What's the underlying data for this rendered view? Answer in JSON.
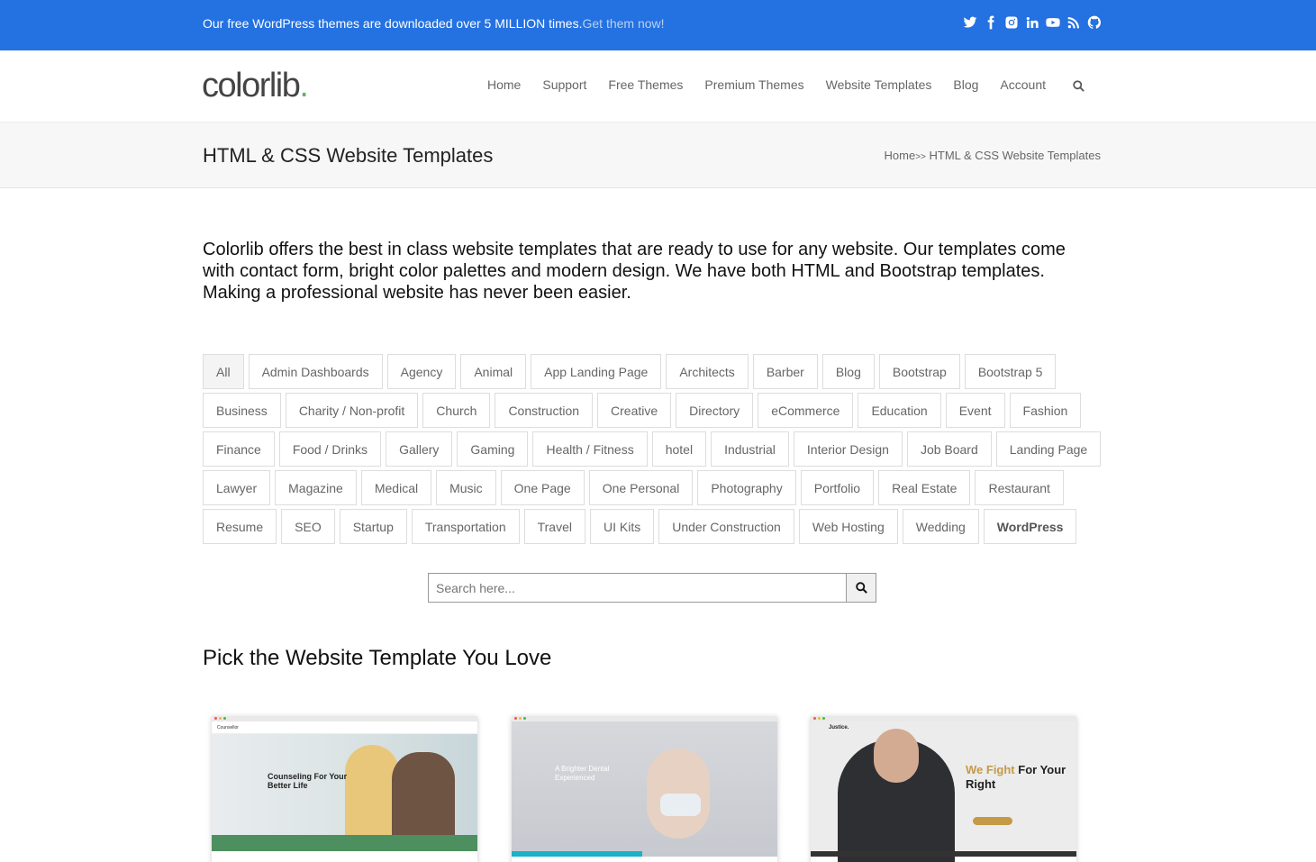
{
  "topbar": {
    "message": "Our free WordPress themes are downloaded over 5 MILLION times.",
    "cta": "Get them now!",
    "social_icons": [
      "twitter-icon",
      "facebook-icon",
      "instagram-icon",
      "linkedin-icon",
      "youtube-icon",
      "rss-icon",
      "github-icon"
    ],
    "bg_color": "#2471e1"
  },
  "header": {
    "logo_text": "colorlib",
    "logo_dot": ".",
    "logo_dot_color": "#5cb85c",
    "nav": [
      "Home",
      "Support",
      "Free Themes",
      "Premium Themes",
      "Website Templates",
      "Blog",
      "Account"
    ],
    "search_icon": "search-icon"
  },
  "title_band": {
    "title": "HTML & CSS Website Templates",
    "breadcrumb_home": "Home",
    "breadcrumb_sep": ">>",
    "breadcrumb_current": "HTML & CSS Website Templates"
  },
  "intro": "Colorlib offers the best in class website templates that are ready to use for any website. Our templates come with contact form, bright color palettes and modern design. We have both HTML and Bootstrap templates. Making a professional website has never been easier.",
  "tags": [
    "All",
    "Admin Dashboards",
    "Agency",
    "Animal",
    "App Landing Page",
    "Architects",
    "Barber",
    "Blog",
    "Bootstrap",
    "Bootstrap 5",
    "Business",
    "Charity / Non-profit",
    "Church",
    "Construction",
    "Creative",
    "Directory",
    "eCommerce",
    "Education",
    "Event",
    "Fashion",
    "Finance",
    "Food / Drinks",
    "Gallery",
    "Gaming",
    "Health / Fitness",
    "hotel",
    "Industrial",
    "Interior Design",
    "Job Board",
    "Landing Page",
    "Lawyer",
    "Magazine",
    "Medical",
    "Music",
    "One Page",
    "One Personal",
    "Photography",
    "Portfolio",
    "Real Estate",
    "Restaurant",
    "Resume",
    "SEO",
    "Startup",
    "Transportation",
    "Travel",
    "UI Kits",
    "Under Construction",
    "Web Hosting",
    "Wedding",
    "WordPress"
  ],
  "active_tag": "All",
  "search": {
    "placeholder": "Search here..."
  },
  "section_title": "Pick the Website Template You Love",
  "cards": [
    {
      "site_name": "Counsellor",
      "headline": "Counseling For Your Better Life"
    },
    {
      "headline": "A Brighter Dental Experienced"
    },
    {
      "site_name": "Justice.",
      "headline_accent": "We Fight",
      "headline_rest": "For Your Right"
    }
  ]
}
